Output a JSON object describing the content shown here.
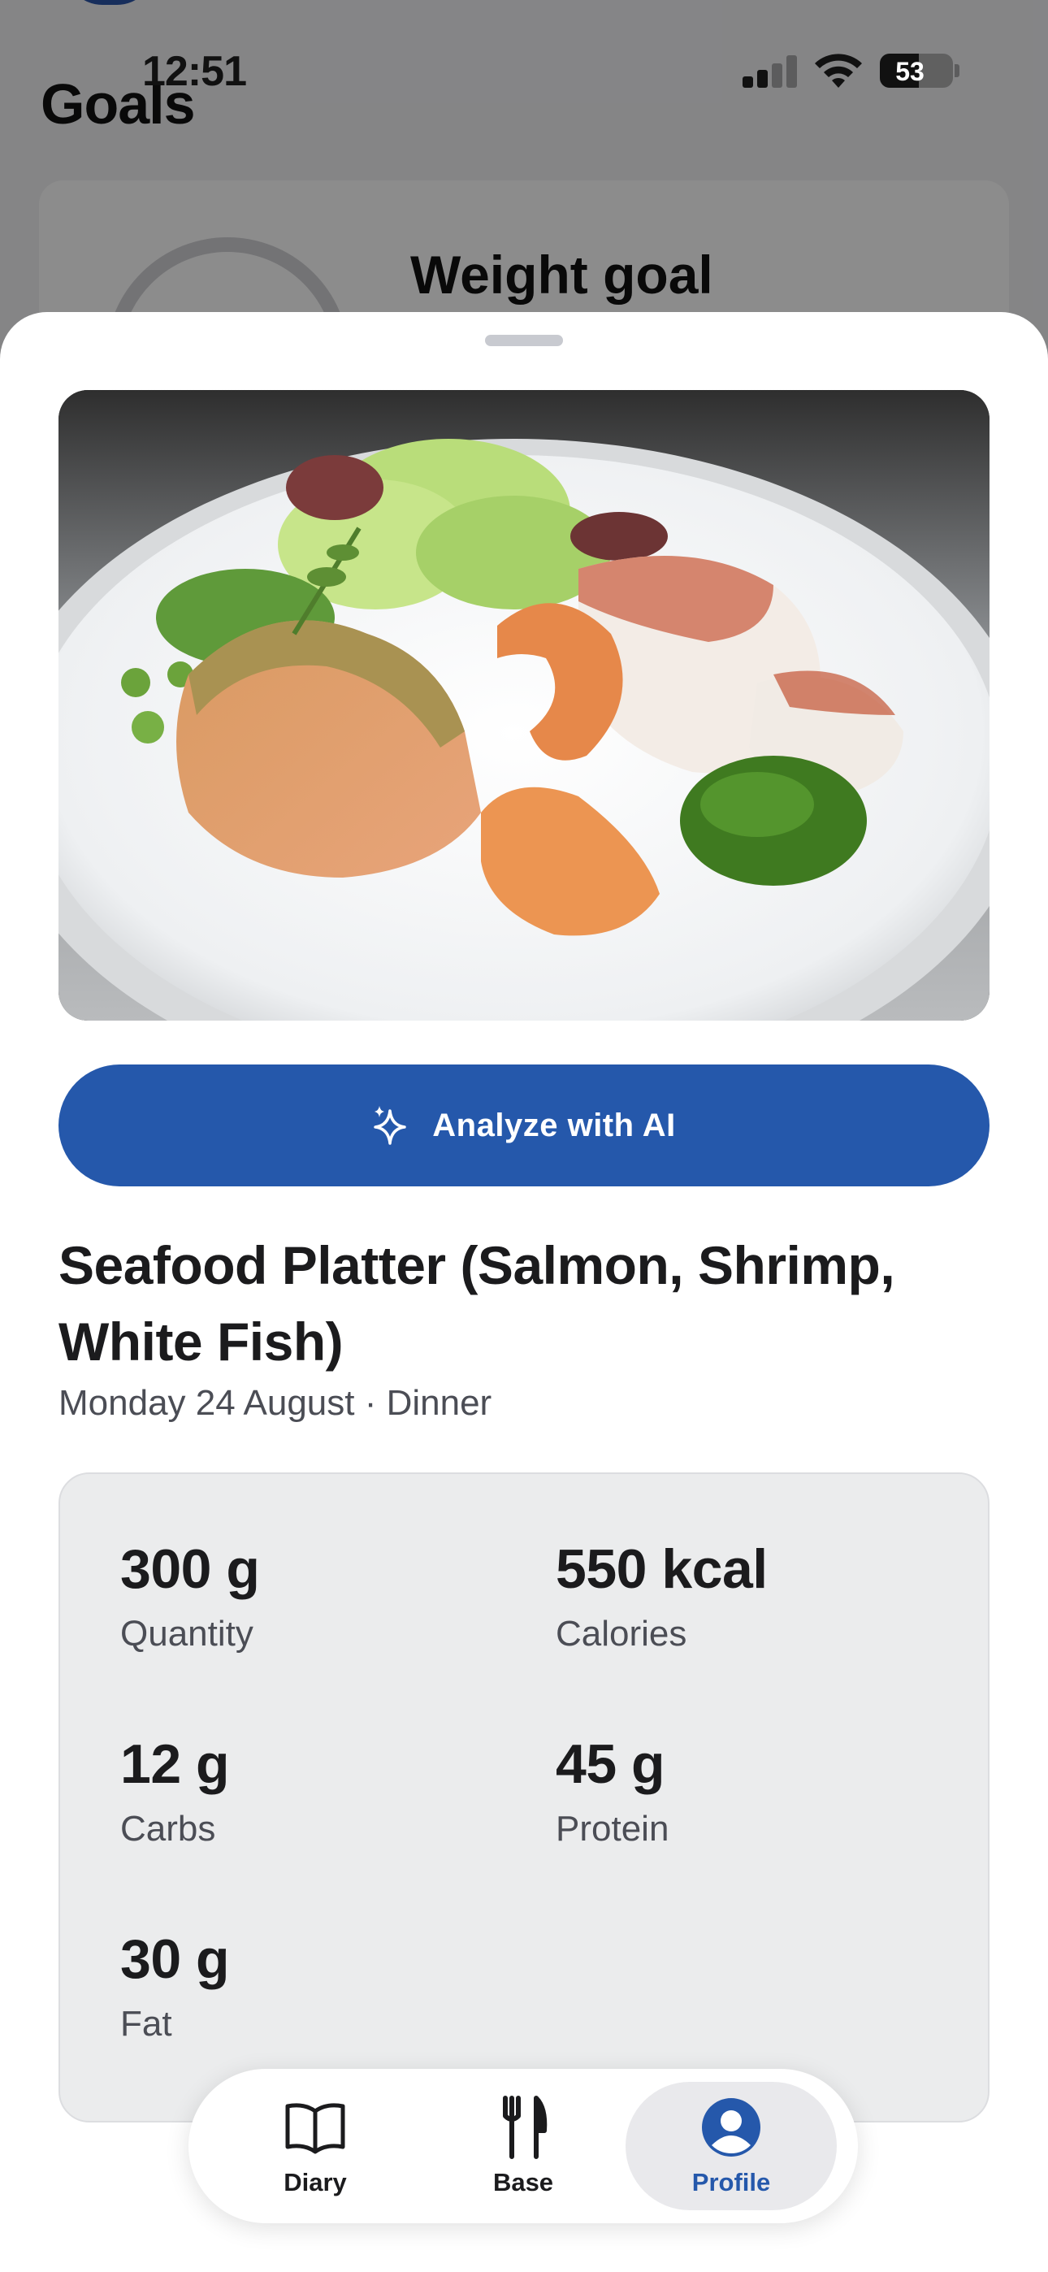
{
  "status_bar": {
    "time": "12:51",
    "battery_level": "53"
  },
  "background_screen": {
    "title": "Goals",
    "card_title": "Weight goal"
  },
  "sheet": {
    "photo_icon": "seafood-platter-photo",
    "ai_button": {
      "label": "Analyze with AI",
      "icon": "sparkles-icon"
    },
    "food": {
      "title": "Seafood Platter (Salmon, Shrimp, White Fish)",
      "subtitle": "Monday 24 August · Dinner"
    },
    "nutrition": [
      {
        "value": "300 g",
        "label": "Quantity"
      },
      {
        "value": "550 kcal",
        "label": "Calories"
      },
      {
        "value": "12 g",
        "label": "Carbs"
      },
      {
        "value": "45 g",
        "label": "Protein"
      },
      {
        "value": "30 g",
        "label": "Fat"
      }
    ]
  },
  "tab_bar": {
    "tabs": [
      {
        "label": "Diary",
        "icon": "book-icon"
      },
      {
        "label": "Base",
        "icon": "fork-knife-icon"
      },
      {
        "label": "Profile",
        "icon": "profile-icon"
      }
    ],
    "active": "Profile"
  },
  "colors": {
    "accent": "#2558ab",
    "card": "#ebeced"
  }
}
